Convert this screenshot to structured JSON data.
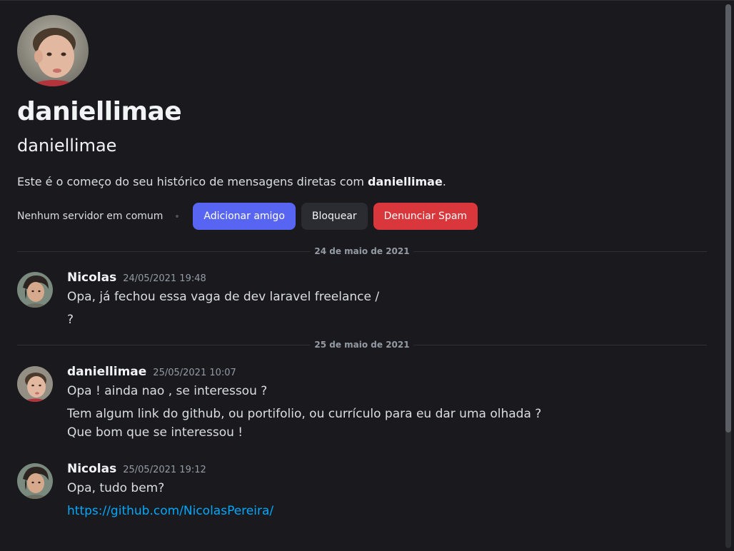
{
  "profile": {
    "display_name": "daniellimae",
    "username": "daniellimae",
    "intro_prefix": "Este é o começo do seu histórico de mensagens diretas com ",
    "intro_name": "daniellimae",
    "intro_suffix": ".",
    "avatar_icon": "child-avatar-image"
  },
  "actions": {
    "no_servers": "Nenhum servidor em comum",
    "add_friend": "Adicionar amigo",
    "block": "Bloquear",
    "report_spam": "Denunciar Spam"
  },
  "colors": {
    "primary": "#5865f2",
    "danger": "#da373c",
    "secondary": "#2b2c31",
    "link": "#00a8fc",
    "background": "#1a1a1e"
  },
  "dividers": [
    "24 de maio de 2021",
    "25 de maio de 2021"
  ],
  "messages": [
    {
      "author": "Nicolas",
      "timestamp": "24/05/2021 19:48",
      "lines": [
        "Opa, já fechou essa vaga de dev laravel freelance /",
        "?"
      ]
    },
    {
      "author": "daniellimae",
      "timestamp": "25/05/2021 10:07",
      "lines": [
        "Opa ! ainda nao , se interessou ?",
        "Tem algum link do github, ou portifolio, ou currículo para eu dar uma olhada ?",
        "Que bom que se interessou !"
      ]
    },
    {
      "author": "Nicolas",
      "timestamp": "25/05/2021 19:12",
      "lines": [
        "Opa, tudo bem?"
      ],
      "link": "https://github.com/NicolasPereira/"
    }
  ]
}
